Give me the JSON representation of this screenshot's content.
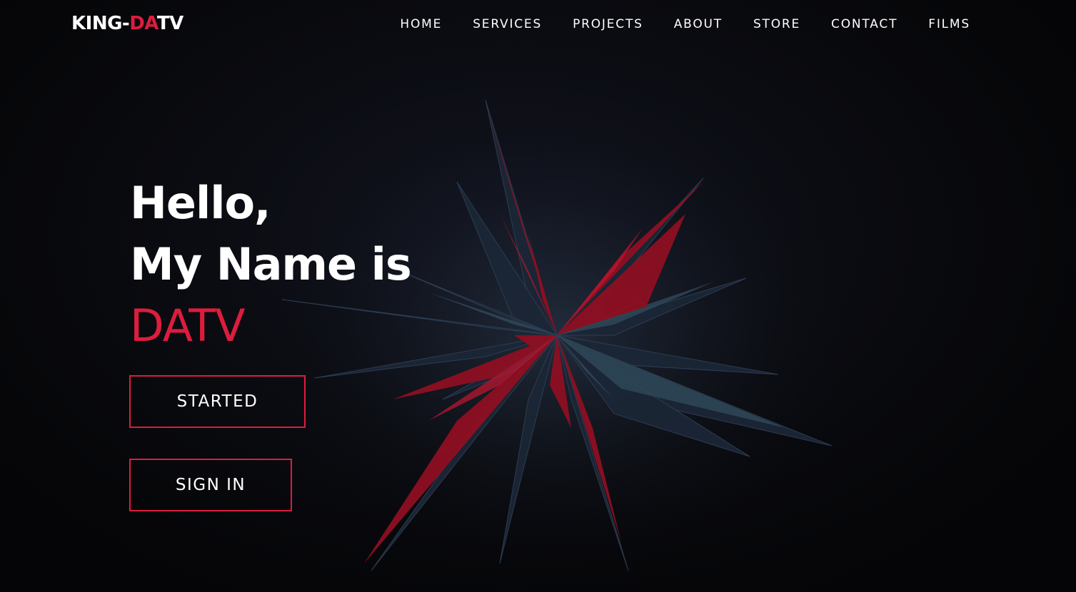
{
  "brand": {
    "logo_prefix": "KING-",
    "logo_accent": "DA",
    "logo_mid": "T",
    "logo_suffix": "V",
    "accent_color": "#dc1d3d",
    "background_color": "#060608"
  },
  "nav": {
    "items": [
      {
        "label": "HOME"
      },
      {
        "label": "SERVICES"
      },
      {
        "label": "PROJECTS"
      },
      {
        "label": "ABOUT"
      },
      {
        "label": "STORE"
      },
      {
        "label": "CONTACT"
      },
      {
        "label": "FILMS"
      }
    ]
  },
  "hero": {
    "line1": "Hello,",
    "line2": "My Name is",
    "name": "DATV",
    "artwork_icon": "abstract-crystal-shards-art"
  },
  "actions": {
    "started_label": "STARTED",
    "signin_label": "SIGN IN"
  }
}
